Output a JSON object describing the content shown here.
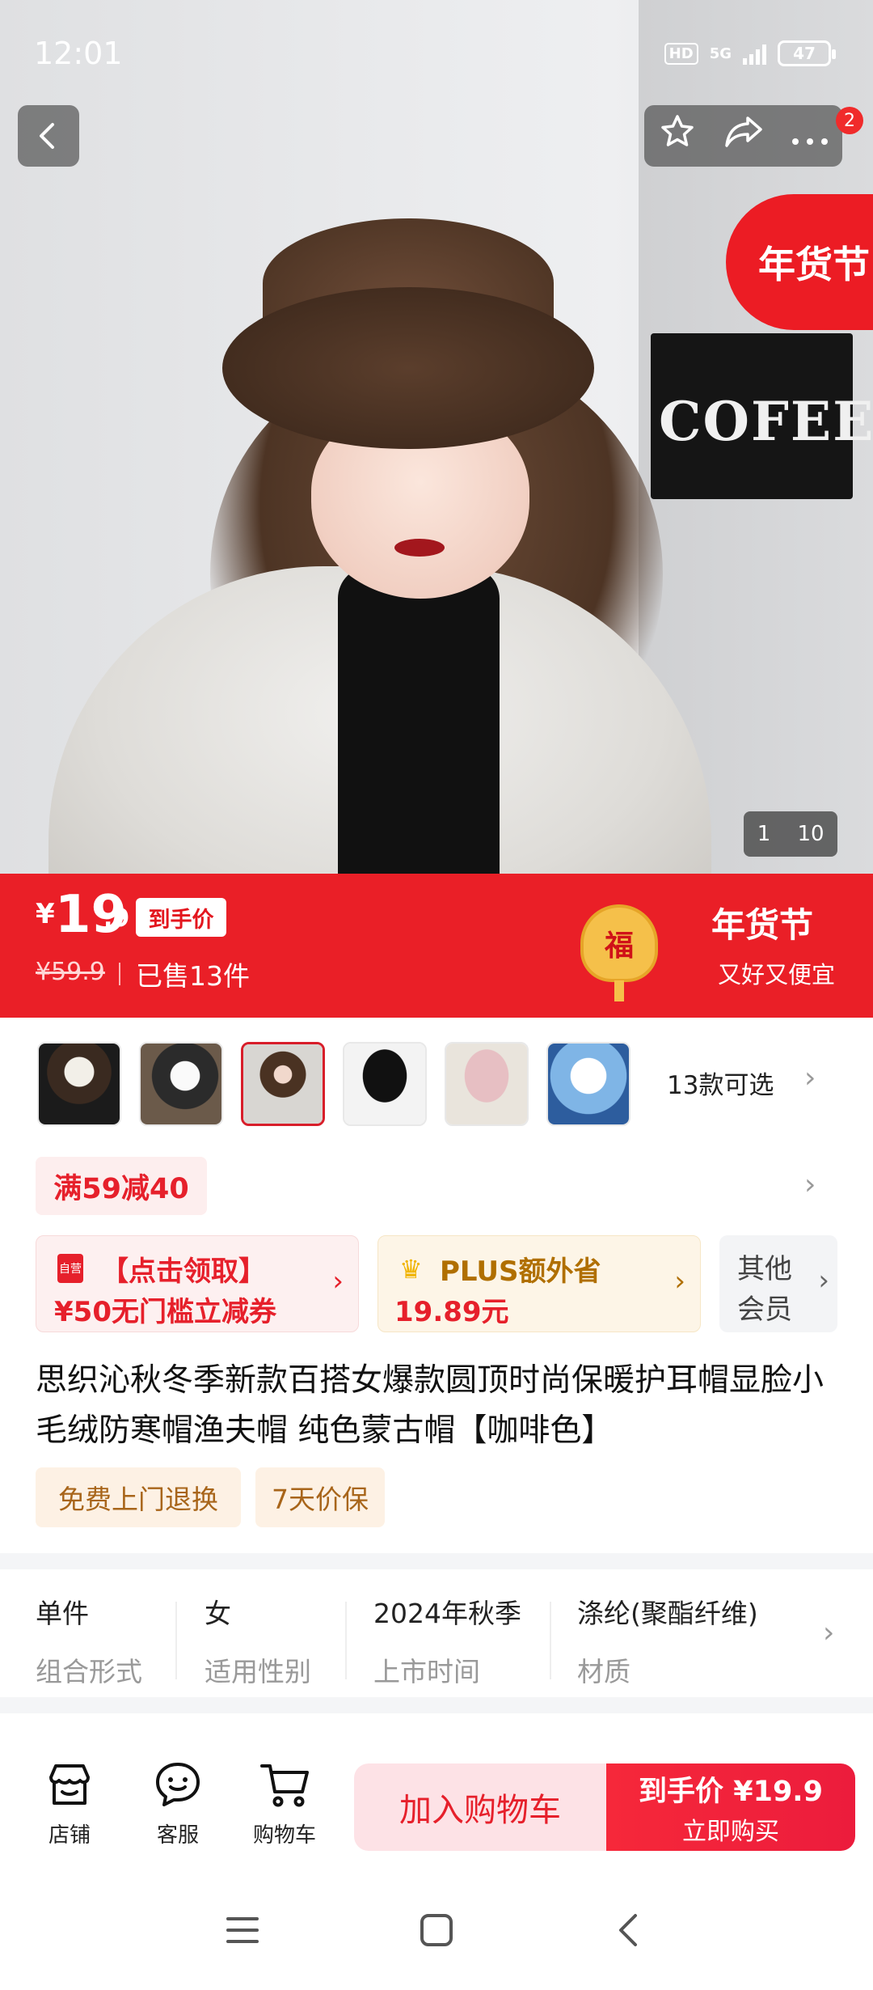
{
  "status_bar": {
    "time": "12:01",
    "hd": "HD",
    "network": "5G",
    "battery": "47"
  },
  "top_actions": {
    "badge_count": "2"
  },
  "festival_tag": "年货节",
  "gallery": {
    "current": "1",
    "total": "10"
  },
  "price_banner": {
    "currency": "¥",
    "price_int": "19",
    "price_dec": ".9",
    "final_price_tag": "到手价",
    "original_price": "¥59.9",
    "sold": "已售13件",
    "fu_char": "福",
    "festival_title": "年货节",
    "festival_sub": "又好又便宜"
  },
  "skus": {
    "more_label": "13款可选"
  },
  "promotion": {
    "label": "满59减40"
  },
  "coupons": [
    {
      "line1": "【点击领取】",
      "line2": "¥50无门槛立减券",
      "icon": "自营"
    },
    {
      "line1": "PLUS额外省",
      "line2": "19.89元"
    },
    {
      "line1": "其他",
      "line2": "会员"
    }
  ],
  "product": {
    "title": "思织沁秋冬季新款百搭女爆款圆顶时尚保暖护耳帽显脸小毛绒防寒帽渔夫帽 纯色蒙古帽【咖啡色】"
  },
  "services": [
    "免费上门退换",
    "7天价保"
  ],
  "attributes": [
    {
      "value": "单件",
      "key": "组合形式"
    },
    {
      "value": "女",
      "key": "适用性别"
    },
    {
      "value": "2024年秋季",
      "key": "上市时间"
    },
    {
      "value": "涤纶(聚酯纤维)",
      "key": "材质"
    }
  ],
  "bottom_bar": {
    "store": "店铺",
    "service": "客服",
    "cart": "购物车",
    "add_to_cart": "加入购物车",
    "buy_line1": "到手价 ¥19.9",
    "buy_line2": "立即购买"
  },
  "hero": {
    "sign_text": "COFEE"
  },
  "colors": {
    "accent_red": "#ea1f27",
    "buy_red": "#f6283a",
    "cart_pink": "#fde2e6"
  }
}
